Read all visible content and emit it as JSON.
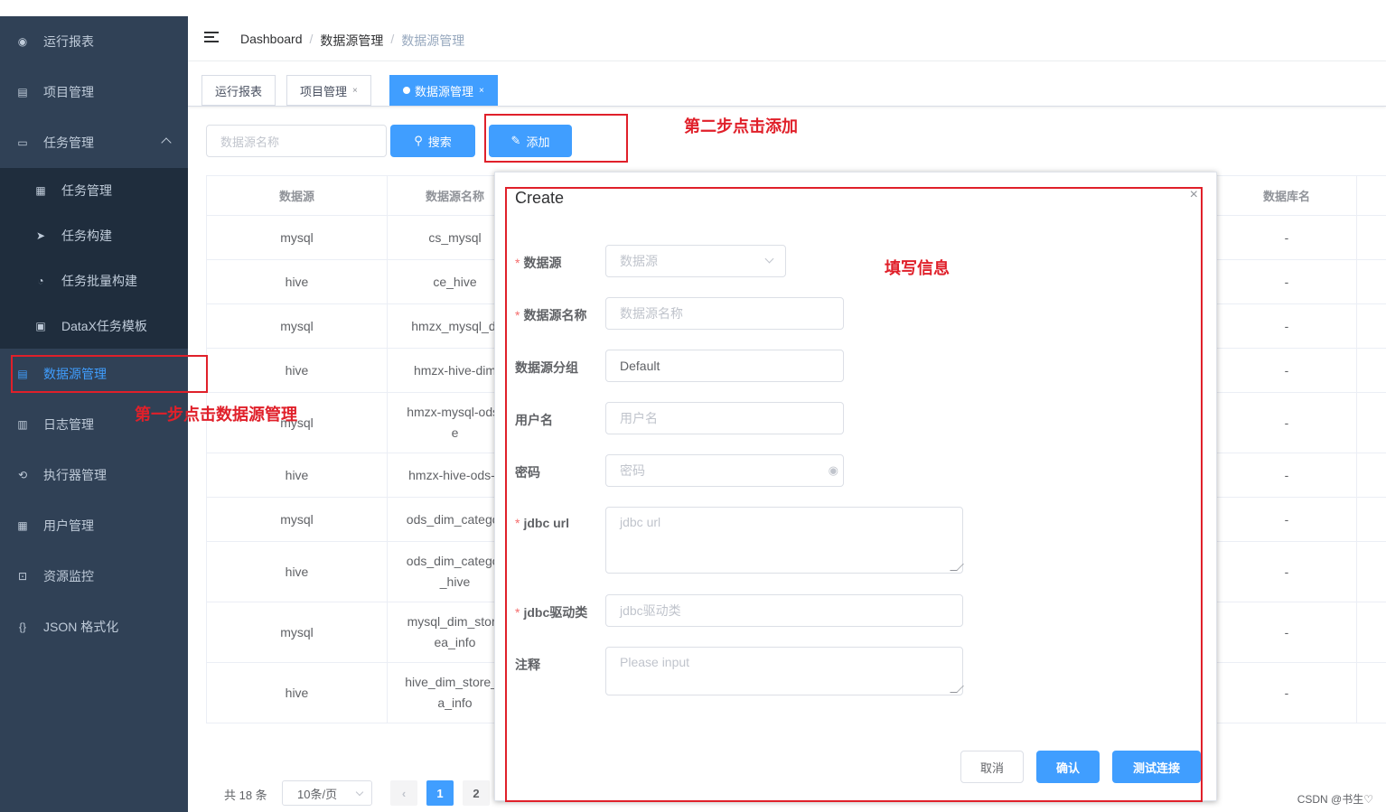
{
  "sidebar": {
    "items": [
      {
        "label": "运行报表",
        "icon": "dashboard-icon"
      },
      {
        "label": "项目管理",
        "icon": "database-icon"
      },
      {
        "label": "任务管理",
        "icon": "monitor-icon"
      },
      {
        "label": "数据源管理",
        "icon": "datasource-icon"
      },
      {
        "label": "日志管理",
        "icon": "document-icon"
      },
      {
        "label": "执行器管理",
        "icon": "refresh-icon"
      },
      {
        "label": "用户管理",
        "icon": "table-icon"
      },
      {
        "label": "资源监控",
        "icon": "monitor-chip-icon"
      },
      {
        "label": "JSON 格式化",
        "icon": "braces-icon"
      }
    ],
    "sub_items": [
      {
        "label": "任务管理",
        "icon": "calendar-icon"
      },
      {
        "label": "任务构建",
        "icon": "send-icon"
      },
      {
        "label": "任务批量构建",
        "icon": "gauge-icon"
      },
      {
        "label": "DataX任务模板",
        "icon": "clipboard-icon"
      }
    ]
  },
  "header": {
    "breadcrumb": [
      "Dashboard",
      "数据源管理",
      "数据源管理"
    ],
    "separator": "/"
  },
  "tags": [
    {
      "label": "运行报表",
      "close": ""
    },
    {
      "label": "项目管理",
      "close": "×"
    },
    {
      "label": "数据源管理",
      "close": "×"
    }
  ],
  "toolbar": {
    "search_placeholder": "数据源名称",
    "search_label": "搜索",
    "add_label": "添加"
  },
  "annotations": {
    "step1": "第一步点击数据源管理",
    "step2": "第二步点击添加",
    "fill": "填写信息"
  },
  "table": {
    "headers": [
      "数据源",
      "数据源名称",
      "数据库名"
    ],
    "rows": [
      {
        "source": "mysql",
        "name": "cs_mysql",
        "db": "-"
      },
      {
        "source": "hive",
        "name": "ce_hive",
        "db": "-"
      },
      {
        "source": "mysql",
        "name": "hmzx_mysql_di",
        "db": "-"
      },
      {
        "source": "hive",
        "name": "hmzx-hive-dim",
        "db": "-"
      },
      {
        "source": "mysql",
        "name": "hmzx-mysql-ods-\ne",
        "db": "-"
      },
      {
        "source": "hive",
        "name": "hmzx-hive-ods-s",
        "db": "-"
      },
      {
        "source": "mysql",
        "name": "ods_dim_categor",
        "db": "-"
      },
      {
        "source": "hive",
        "name": "ods_dim_categor\n_hive",
        "db": "-"
      },
      {
        "source": "mysql",
        "name": "mysql_dim_store\nea_info",
        "db": "-"
      },
      {
        "source": "hive",
        "name": "hive_dim_store_a\na_info",
        "db": "-"
      }
    ]
  },
  "pagination": {
    "total": "共 18 条",
    "page_size": "10条/页",
    "prev": "‹",
    "pages": [
      "1",
      "2"
    ]
  },
  "dialog": {
    "title": "Create",
    "close": "×",
    "fields": [
      {
        "label": "数据源",
        "required": "*",
        "value": "",
        "placeholder": "数据源"
      },
      {
        "label": "数据源名称",
        "required": "*",
        "value": "",
        "placeholder": "数据源名称"
      },
      {
        "label": "数据源分组",
        "required": "",
        "value": "Default",
        "placeholder": ""
      },
      {
        "label": "用户名",
        "required": "",
        "value": "",
        "placeholder": "用户名"
      },
      {
        "label": "密码",
        "required": "",
        "value": "",
        "placeholder": "密码"
      },
      {
        "label": "jdbc url",
        "required": "*",
        "value": "",
        "placeholder": "jdbc url"
      },
      {
        "label": "jdbc驱动类",
        "required": "*",
        "value": "",
        "placeholder": "jdbc驱动类"
      },
      {
        "label": "注释",
        "required": "",
        "value": "",
        "placeholder": "Please input"
      }
    ],
    "cancel_label": "取消",
    "confirm_label": "确认",
    "test_label": "测试连接"
  },
  "watermark": "CSDN @书生♡",
  "colors": {
    "sidebar_bg": "#304156",
    "primary": "#409eff",
    "annotation": "#e0202a"
  }
}
